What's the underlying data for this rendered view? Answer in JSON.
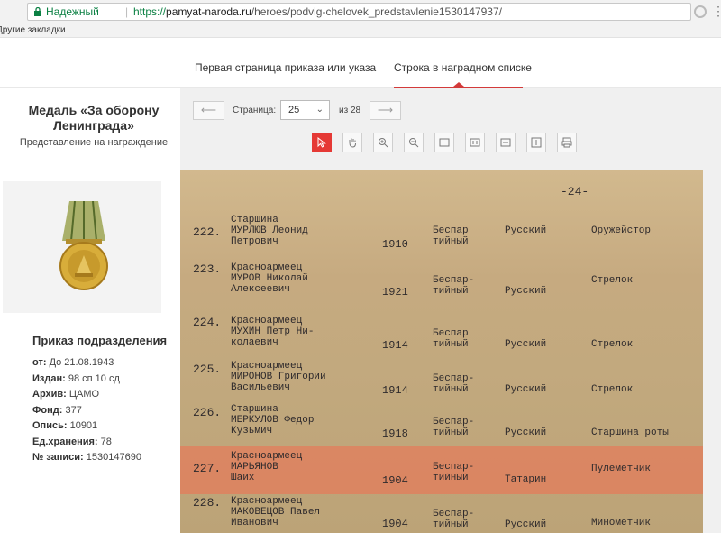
{
  "browser": {
    "secure_label": "Надежный",
    "url_scheme": "https://",
    "url_host": "pamyat-naroda.ru",
    "url_path": "/heroes/podvig-chelovek_predstavlenie1530147937/",
    "bookmarks_label": "Другие закладки"
  },
  "tabs": [
    {
      "label": "Первая страница приказа или указа",
      "active": false
    },
    {
      "label": "Строка в наградном списке",
      "active": true
    }
  ],
  "sidebar": {
    "medal_title": "Медаль «За оборону Ленинграда»",
    "medal_subtitle": "Представление на награждение",
    "order_title": "Приказ подразделения",
    "meta": [
      {
        "label": "от:",
        "value": "До 21.08.1943"
      },
      {
        "label": "Издан:",
        "value": "98 сп 10 сд"
      },
      {
        "label": "Архив:",
        "value": "ЦАМО"
      },
      {
        "label": "Фонд:",
        "value": "377"
      },
      {
        "label": "Опись:",
        "value": "10901"
      },
      {
        "label": "Ед.хранения:",
        "value": "78"
      },
      {
        "label": "№ записи:",
        "value": "1530147690"
      }
    ]
  },
  "pager": {
    "prev_label": "⟵",
    "next_label": "⟶",
    "page_label": "Страница:",
    "current_page": "25",
    "of_label": "из 28"
  },
  "tools": [
    "pointer-icon",
    "hand-icon",
    "zoom-in-icon",
    "zoom-out-icon",
    "fit-page-icon",
    "actual-size-icon",
    "fit-width-icon",
    "fit-height-icon",
    "print-icon"
  ],
  "document": {
    "page_number": "-24-",
    "rows": [
      {
        "num": "222.",
        "name": [
          "Старшина",
          "МУРЛЮВ Леонид",
          "Петрович"
        ],
        "year": "1910",
        "party": [
          "Беспар",
          "тийный"
        ],
        "nationality": "Русский",
        "role": "Оружейстор"
      },
      {
        "num": "223.",
        "name": [
          "Красноармеец",
          "МУРОВ Николай",
          "Алексеевич"
        ],
        "year": "1921",
        "party": [
          "Беспар-",
          "тийный"
        ],
        "nationality": "Русский",
        "role": "Стрелок"
      },
      {
        "num": "224.",
        "name": [
          "Красноармеец",
          "МУХИН Петр Ни-",
          "колаевич"
        ],
        "year": "1914",
        "party": [
          "Беспар",
          "тийный"
        ],
        "nationality": "Русский",
        "role": "Стрелок"
      },
      {
        "num": "225.",
        "name": [
          "Красноармеец",
          "МИРОНОВ Григорий",
          "Васильевич"
        ],
        "year": "1914",
        "party": [
          "Беспар-",
          "тийный"
        ],
        "nationality": "Русский",
        "role": "Стрелок"
      },
      {
        "num": "226.",
        "name": [
          "Старшина",
          "МЕРКУЛОВ Федор",
          "Кузьмич"
        ],
        "year": "1918",
        "party": [
          "Беспар-",
          "тийный"
        ],
        "nationality": "Русский",
        "role": "Старшина роты"
      },
      {
        "num": "227.",
        "name": [
          "Красноармеец",
          "МАРЬЯНОВ",
          "Шаих"
        ],
        "year": "1904",
        "party": [
          "Беспар-",
          "тийный"
        ],
        "nationality": "Татарин",
        "role": "Пулеметчик"
      },
      {
        "num": "228.",
        "name": [
          "Красноармеец",
          "МАКОВЕЦОВ Павел",
          "Иванович"
        ],
        "year": "1904",
        "party": [
          "Беспар-",
          "тийный"
        ],
        "nationality": "Русский",
        "role": "Минометчик"
      }
    ]
  },
  "colors": {
    "accent": "#d33a3a",
    "highlight": "#f06e50",
    "secure": "#0b8043"
  }
}
